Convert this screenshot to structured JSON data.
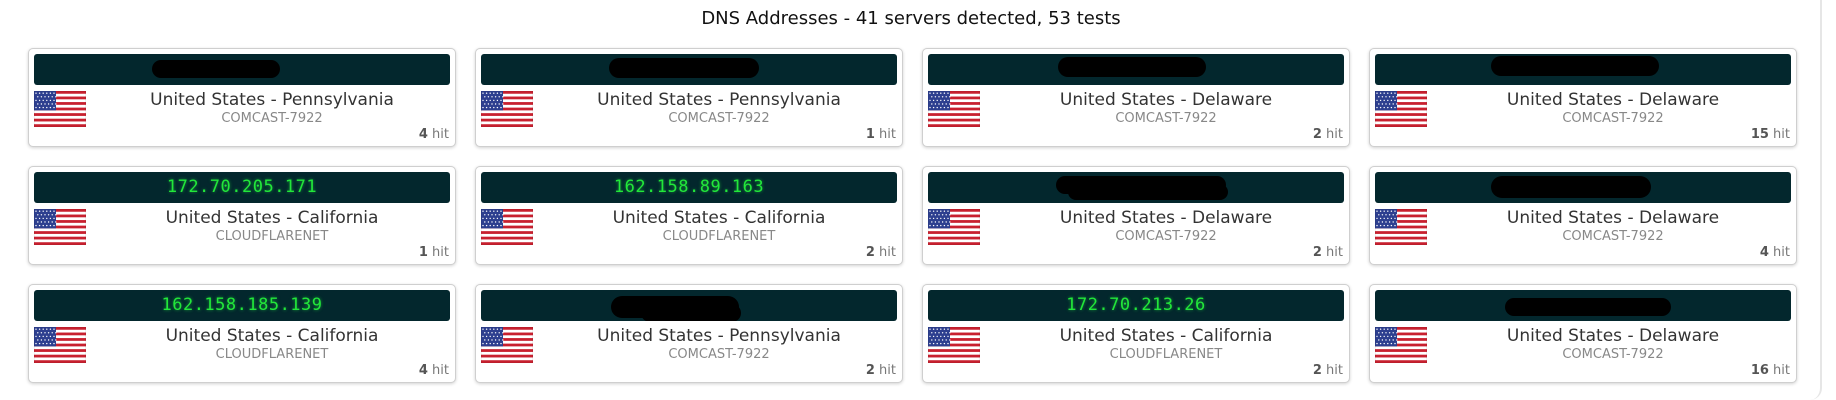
{
  "header": {
    "title": "DNS Addresses - 41 servers detected, 53 tests"
  },
  "colors": {
    "ip_bar_bg": "#03272d",
    "ip_text": "#22e73a"
  },
  "flag_icon": "us-flag-icon",
  "servers": [
    {
      "ip": "",
      "redacted": true,
      "location": "United States - Pennsylvania",
      "isp": "COMCAST-7922",
      "hits": "4",
      "hit_label": "hit"
    },
    {
      "ip": "",
      "redacted": true,
      "location": "United States - Pennsylvania",
      "isp": "COMCAST-7922",
      "hits": "1",
      "hit_label": "hit"
    },
    {
      "ip": "",
      "redacted": true,
      "location": "United States - Delaware",
      "isp": "COMCAST-7922",
      "hits": "2",
      "hit_label": "hit"
    },
    {
      "ip": "",
      "redacted": true,
      "location": "United States - Delaware",
      "isp": "COMCAST-7922",
      "hits": "15",
      "hit_label": "hit"
    },
    {
      "ip": "172.70.205.171",
      "redacted": false,
      "location": "United States - California",
      "isp": "CLOUDFLARENET",
      "hits": "1",
      "hit_label": "hit"
    },
    {
      "ip": "162.158.89.163",
      "redacted": false,
      "location": "United States - California",
      "isp": "CLOUDFLARENET",
      "hits": "2",
      "hit_label": "hit"
    },
    {
      "ip": "",
      "redacted": true,
      "location": "United States - Delaware",
      "isp": "COMCAST-7922",
      "hits": "2",
      "hit_label": "hit"
    },
    {
      "ip": "",
      "redacted": true,
      "location": "United States - Delaware",
      "isp": "COMCAST-7922",
      "hits": "4",
      "hit_label": "hit"
    },
    {
      "ip": "162.158.185.139",
      "redacted": false,
      "location": "United States - California",
      "isp": "CLOUDFLARENET",
      "hits": "4",
      "hit_label": "hit"
    },
    {
      "ip": "",
      "redacted": true,
      "location": "United States - Pennsylvania",
      "isp": "COMCAST-7922",
      "hits": "2",
      "hit_label": "hit"
    },
    {
      "ip": "172.70.213.26",
      "redacted": false,
      "location": "United States - California",
      "isp": "CLOUDFLARENET",
      "hits": "2",
      "hit_label": "hit"
    },
    {
      "ip": "",
      "redacted": true,
      "location": "United States - Delaware",
      "isp": "COMCAST-7922",
      "hits": "16",
      "hit_label": "hit"
    }
  ]
}
